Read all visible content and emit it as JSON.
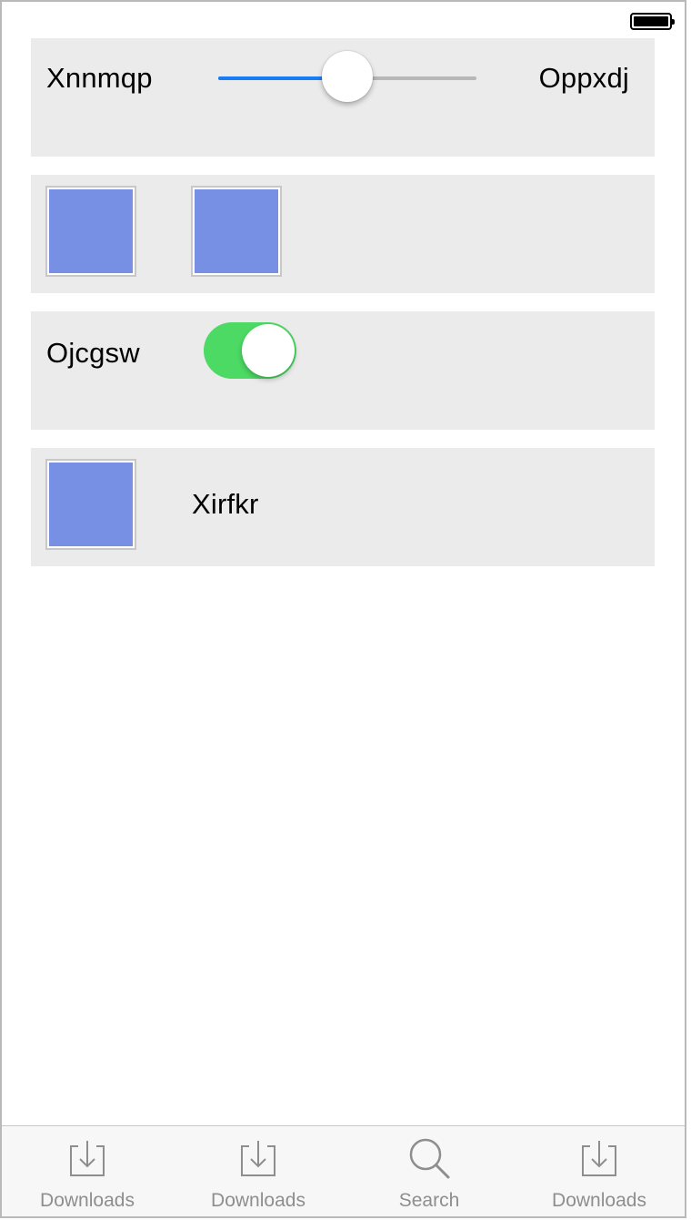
{
  "slider_row": {
    "left_label": "Xnnmqp",
    "right_label": "Oppxdj",
    "value": 0.5,
    "track_color": "#1a7cf4"
  },
  "toggle_row": {
    "label": "Ojcgsw",
    "on": true,
    "color": "#4cd964"
  },
  "image_row": {
    "label": "Xirfkr"
  },
  "placeholder_color": "#7890e3",
  "tabbar": {
    "tabs": [
      {
        "label": "Downloads",
        "icon": "download-icon"
      },
      {
        "label": "Downloads",
        "icon": "download-icon"
      },
      {
        "label": "Search",
        "icon": "search-icon"
      },
      {
        "label": "Downloads",
        "icon": "download-icon"
      }
    ]
  }
}
